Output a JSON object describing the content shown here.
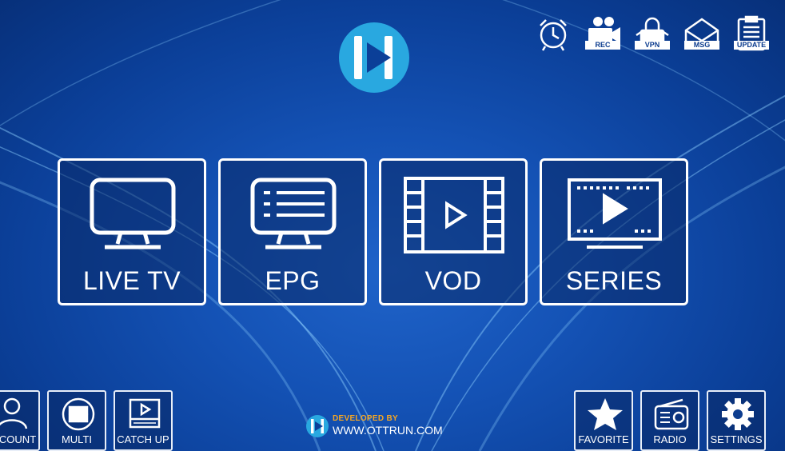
{
  "colors": {
    "background": "#1452b5",
    "tile_border": "#ffffff",
    "logo_blue": "#29a8e0",
    "developer_text": "#f5a623"
  },
  "top_bar": {
    "icons": [
      {
        "name": "alarm-clock-icon",
        "tag": ""
      },
      {
        "name": "record-camera-icon",
        "tag": "REC"
      },
      {
        "name": "vpn-lock-icon",
        "tag": "VPN"
      },
      {
        "name": "message-envelope-icon",
        "tag": "MSG"
      },
      {
        "name": "update-clipboard-icon",
        "tag": "UPDATE"
      }
    ]
  },
  "main_tiles": [
    {
      "label": "LIVE TV",
      "icon": "monitor-icon"
    },
    {
      "label": "EPG",
      "icon": "tv-guide-icon"
    },
    {
      "label": "VOD",
      "icon": "film-strip-play-icon"
    },
    {
      "label": "SERIES",
      "icon": "series-screen-play-icon"
    }
  ],
  "bottom_left": [
    {
      "label": "ACCOUNT",
      "icon": "user-account-icon"
    },
    {
      "label": "MULTI",
      "icon": "multi-screen-icon"
    },
    {
      "label": "CATCH UP",
      "icon": "catch-up-player-icon"
    }
  ],
  "bottom_right": [
    {
      "label": "FAVORITE",
      "icon": "star-icon"
    },
    {
      "label": "RADIO",
      "icon": "radio-icon"
    },
    {
      "label": "SETTINGS",
      "icon": "gear-icon"
    }
  ],
  "developer": {
    "line1": "DEVELOPED BY",
    "url": "WWW.OTTRUN.COM"
  }
}
